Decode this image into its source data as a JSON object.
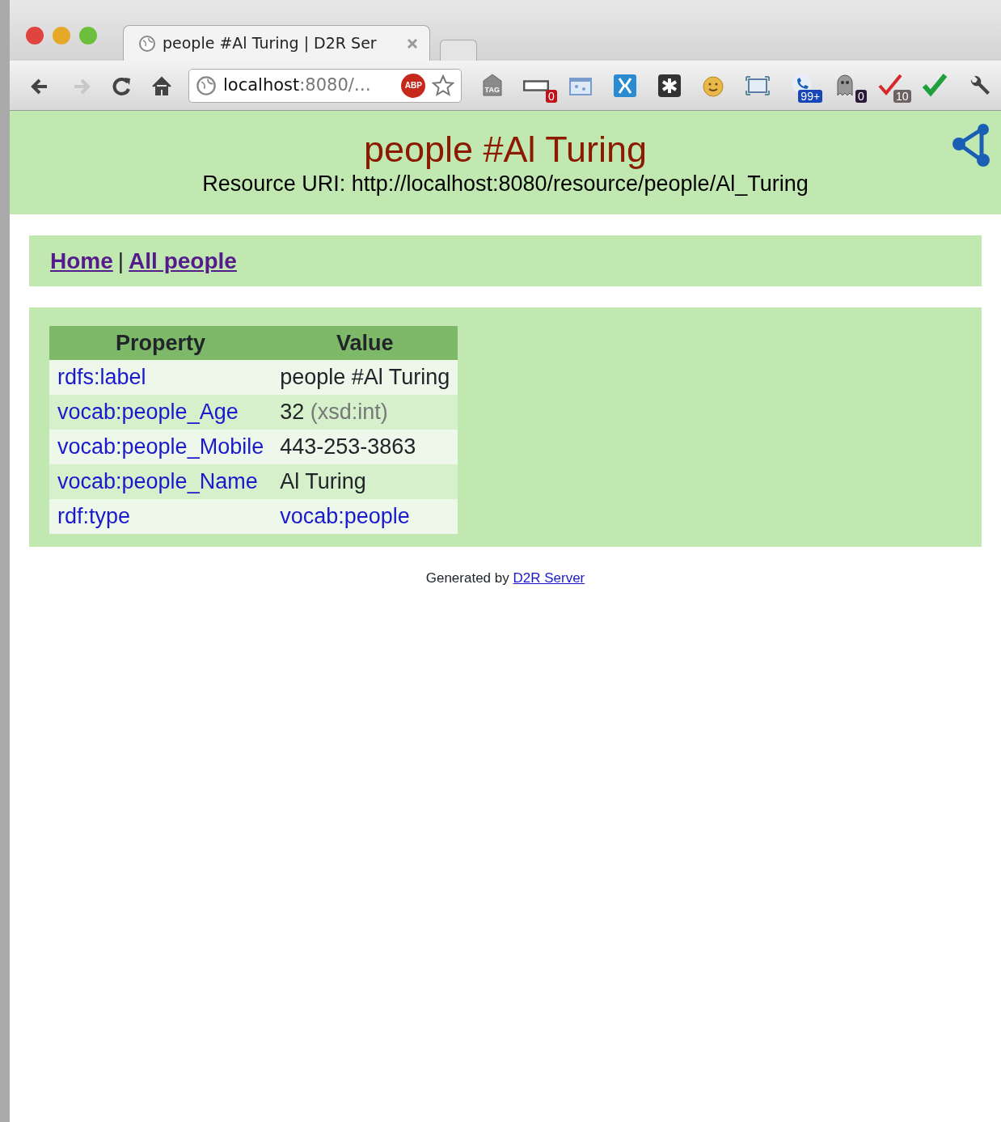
{
  "browser": {
    "tab": {
      "title": "people #Al Turing | D2R Ser",
      "selected": true
    },
    "nav_buttons": [
      {
        "kind": "back",
        "disabled": false
      },
      {
        "kind": "forward",
        "disabled": true
      },
      {
        "kind": "reload",
        "disabled": false
      },
      {
        "kind": "home",
        "disabled": false
      }
    ],
    "address": {
      "host": "localhost",
      "rest": ":8080/…",
      "adblock": "ABP"
    },
    "extensions": [
      {
        "kind": "tag",
        "label": "TAG"
      },
      {
        "kind": "bar",
        "badge": "0",
        "color": "#c0101a"
      },
      {
        "kind": "window"
      },
      {
        "kind": "butterfly"
      },
      {
        "kind": "asterisk"
      },
      {
        "kind": "face"
      },
      {
        "kind": "screen"
      },
      {
        "kind": "phone",
        "badge": "99+",
        "color": "#1746b8"
      },
      {
        "kind": "ghost",
        "badge": "0",
        "color": "#2a1a3a"
      },
      {
        "kind": "redcheck",
        "badge": "10",
        "color": "#6b6262"
      },
      {
        "kind": "check"
      },
      {
        "kind": "wrench"
      }
    ]
  },
  "page": {
    "title": "people #Al Turing",
    "uri_label": "Resource URI:",
    "uri": "http://localhost:8080/resource/people/Al_Turing",
    "nav": [
      "Home",
      "All people"
    ],
    "nav_separator": "|",
    "table": {
      "columns": [
        "Property",
        "Value"
      ],
      "rows": [
        {
          "property": "rdfs:label",
          "value": "people #Al Turing",
          "kind": "literal"
        },
        {
          "property": "vocab:people_Age",
          "value": "32",
          "datatype": "(xsd:int)",
          "kind": "literal"
        },
        {
          "property": "vocab:people_Mobile",
          "value": "443-253-3863",
          "kind": "literal"
        },
        {
          "property": "vocab:people_Name",
          "value": "Al Turing",
          "kind": "literal"
        },
        {
          "property": "rdf:type",
          "value": "vocab:people",
          "kind": "link"
        }
      ]
    },
    "footer": {
      "text": "Generated by",
      "link": "D2R Server"
    }
  }
}
